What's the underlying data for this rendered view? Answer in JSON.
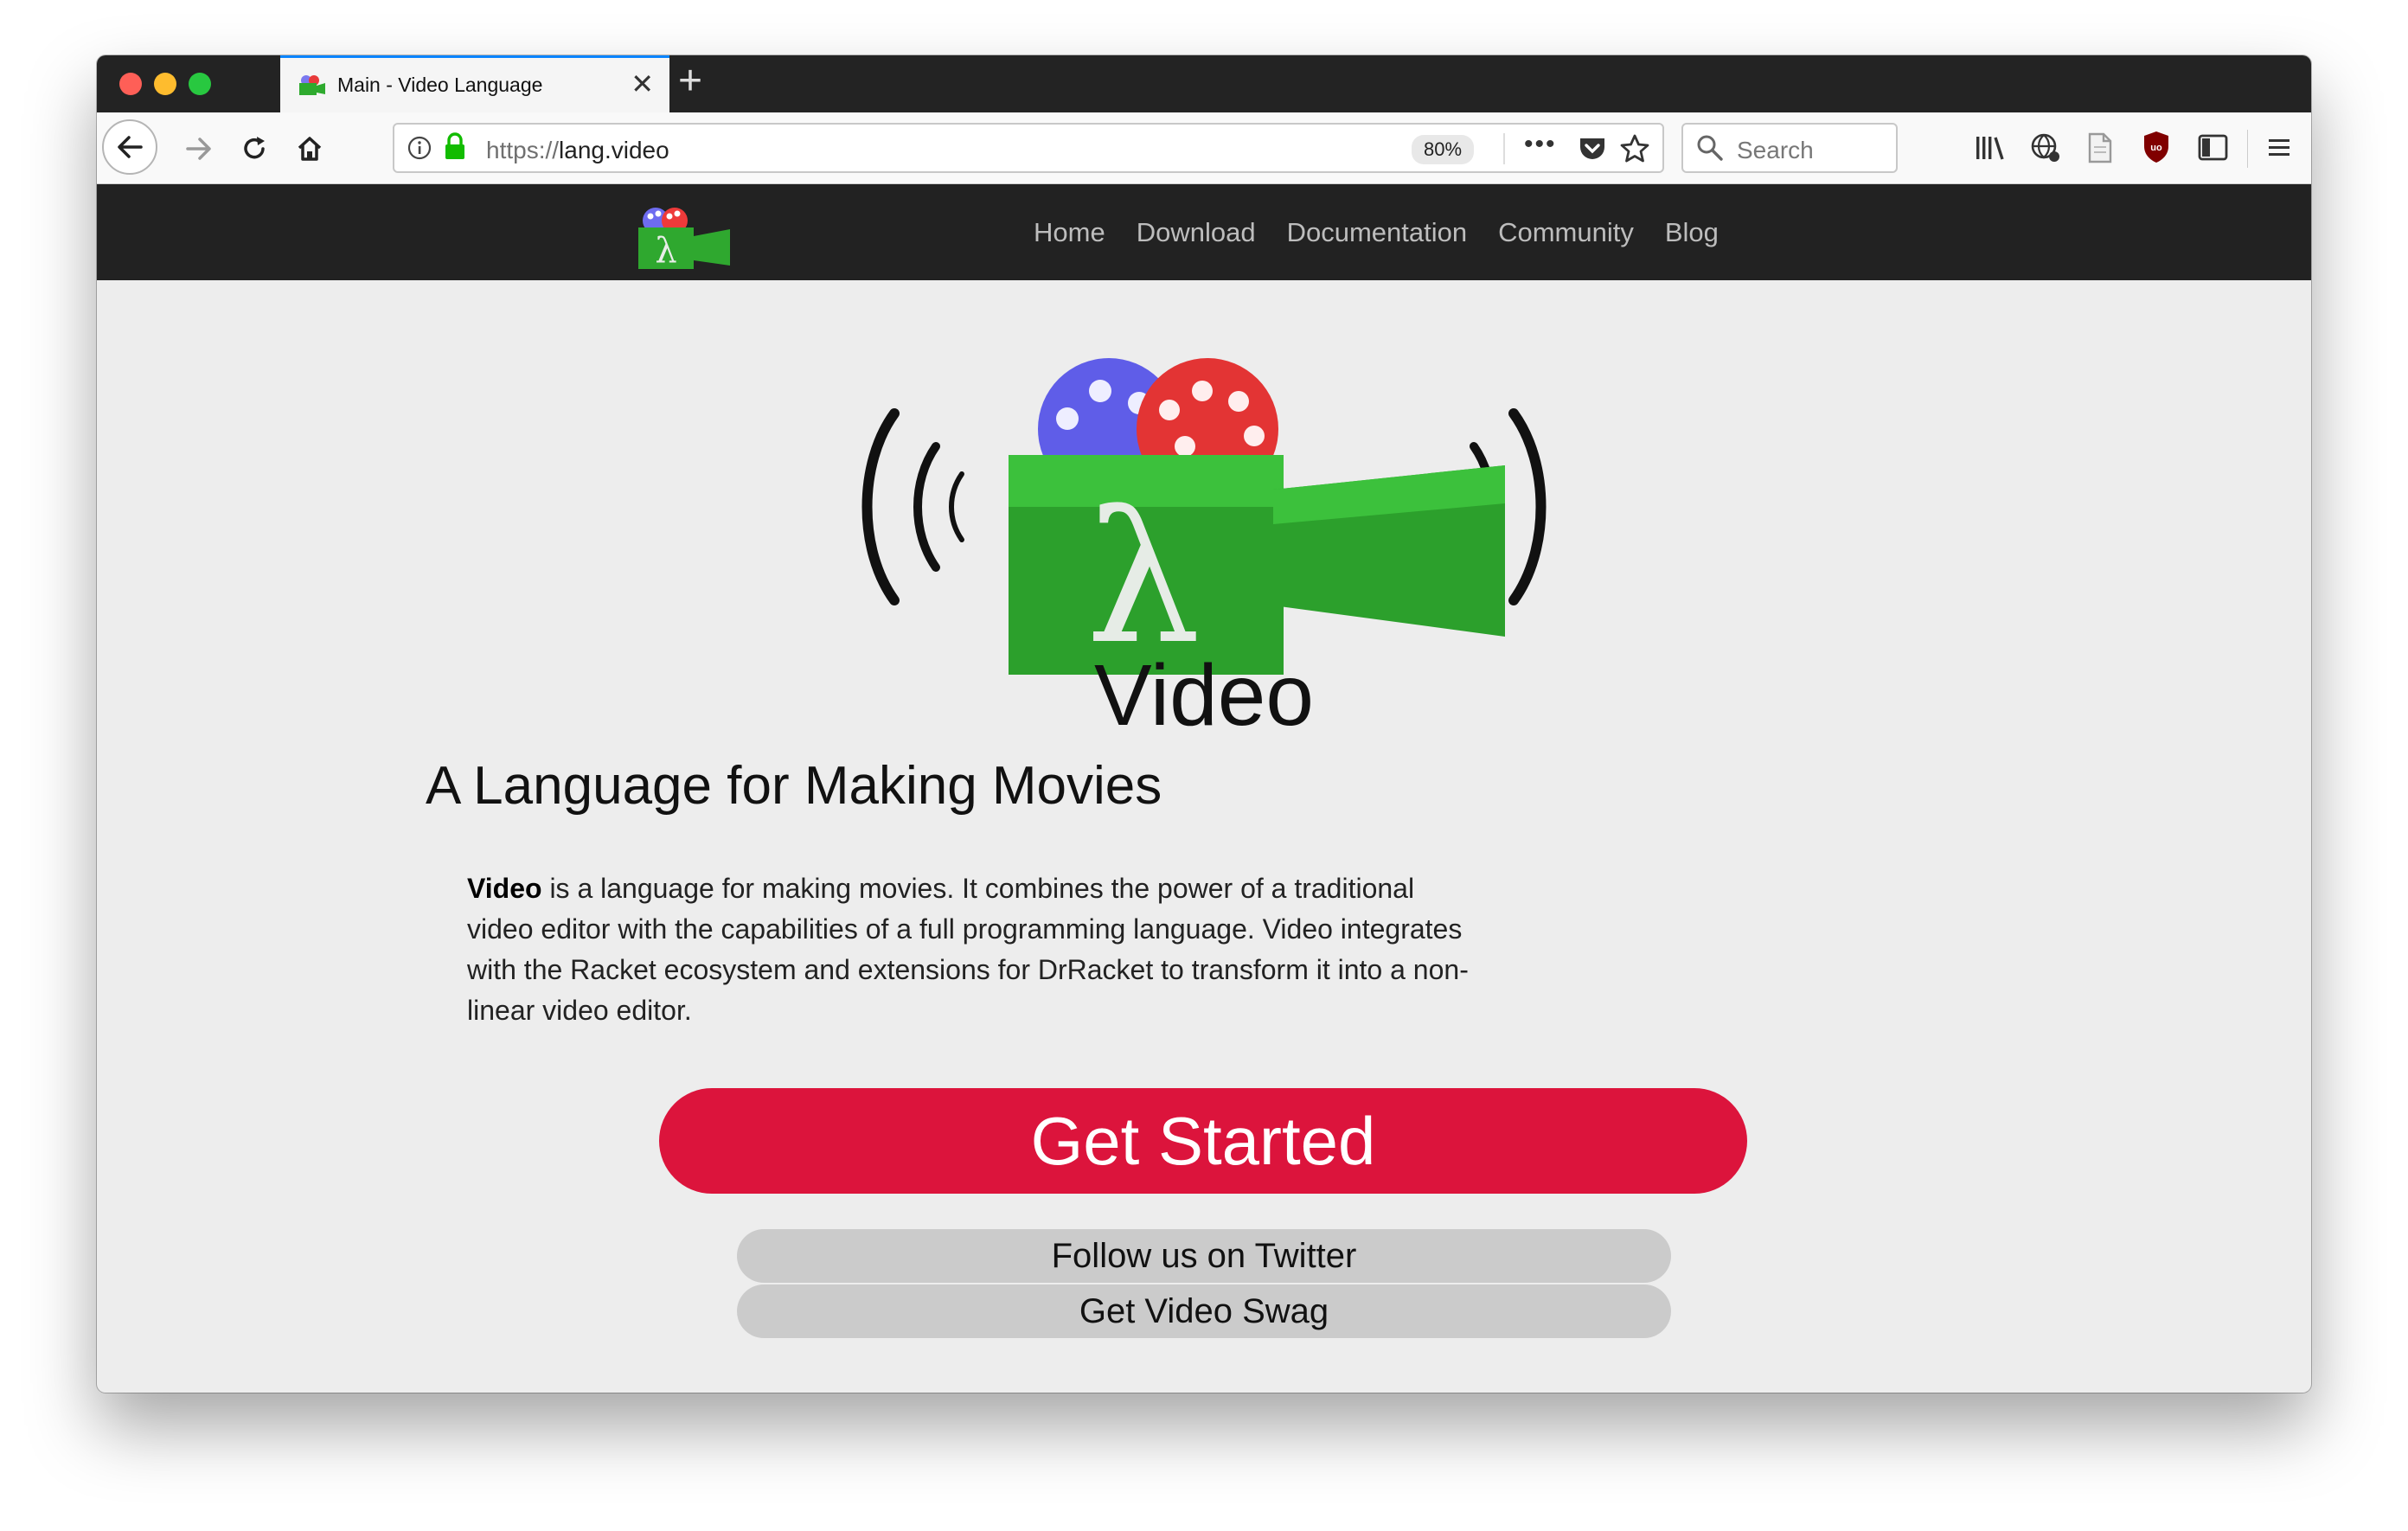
{
  "browser": {
    "tab_title": "Main - Video Language",
    "url_protocol": "https://",
    "url_host": "lang.video",
    "zoom": "80%",
    "search_placeholder": "Search"
  },
  "site": {
    "nav": [
      "Home",
      "Download",
      "Documentation",
      "Community",
      "Blog"
    ]
  },
  "main": {
    "title": "Video",
    "subtitle": "A Language for Making Movies",
    "desc_lead": "Video",
    "desc_body": " is a language for making movies. It combines the power of a traditional video editor with the capabilities of a full programming language. Video integrates with the Racket ecosystem and extensions for DrRacket to transform it into a non-linear video editor.",
    "cta_primary": "Get Started",
    "cta_twitter": "Follow us on Twitter",
    "cta_swag": "Get Video Swag"
  },
  "colors": {
    "primary_button": "#dc143c",
    "site_header": "#222222",
    "page_bg": "#ededed"
  }
}
